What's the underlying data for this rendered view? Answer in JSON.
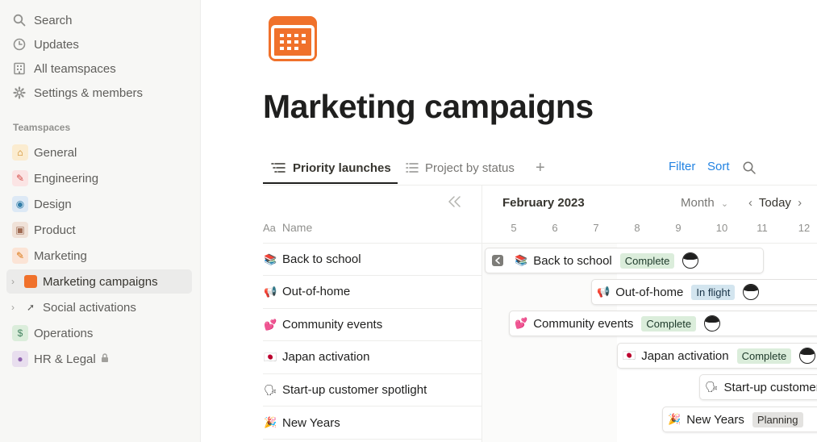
{
  "sidebar": {
    "nav": [
      {
        "label": "Search",
        "icon": "search-icon"
      },
      {
        "label": "Updates",
        "icon": "clock-icon"
      },
      {
        "label": "All teamspaces",
        "icon": "building-icon"
      },
      {
        "label": "Settings & members",
        "icon": "gear-icon"
      }
    ],
    "section_label": "Teamspaces",
    "teamspaces": [
      {
        "label": "General",
        "icon": "house-icon",
        "glyph": "⌂",
        "bg": "#fbecd0",
        "fg": "#c77d0e"
      },
      {
        "label": "Engineering",
        "icon": "wrench-icon",
        "glyph": "✎",
        "bg": "#fbe4e4",
        "fg": "#d44c47"
      },
      {
        "label": "Design",
        "icon": "palette-icon",
        "glyph": "◉",
        "bg": "#dde9f5",
        "fg": "#337ea9"
      },
      {
        "label": "Product",
        "icon": "box-icon",
        "glyph": "▣",
        "bg": "#f0e2d8",
        "fg": "#9f6b53"
      },
      {
        "label": "Marketing",
        "icon": "megaphone-icon",
        "glyph": "✎",
        "bg": "#fbe4d6",
        "fg": "#d9730d"
      },
      {
        "label": "Marketing campaigns",
        "icon": "calendar-icon"
      },
      {
        "label": "Social activations",
        "icon": "rocket-icon"
      },
      {
        "label": "Operations",
        "icon": "dollar-icon",
        "glyph": "$",
        "bg": "#dbeddb",
        "fg": "#448361"
      },
      {
        "label": "HR & Legal",
        "icon": "person-icon",
        "glyph": "●",
        "bg": "#e8deee",
        "fg": "#9065b0"
      }
    ]
  },
  "page": {
    "title": "Marketing campaigns",
    "icon": "calendar-icon",
    "accent": "#f0712b"
  },
  "tabs": {
    "items": [
      {
        "label": "Priority launches",
        "icon": "list-icon"
      },
      {
        "label": "Project by status",
        "icon": "list-icon"
      }
    ],
    "add": "+",
    "filter": "Filter",
    "sort": "Sort"
  },
  "table": {
    "column_type": "Aa",
    "column_name": "Name",
    "rows": [
      {
        "name": "Back to school",
        "emoji": "📚"
      },
      {
        "name": "Out-of-home",
        "emoji": "📢"
      },
      {
        "name": "Community events",
        "emoji": "💕"
      },
      {
        "name": "Japan activation",
        "emoji": "🇯🇵"
      },
      {
        "name": "Start-up customer spotlight",
        "emoji": "🗣"
      },
      {
        "name": "New Years",
        "emoji": "🎉"
      }
    ]
  },
  "timeline": {
    "month": "February 2023",
    "scale": "Month",
    "today": "Today",
    "days": [
      "5",
      "6",
      "7",
      "8",
      "9",
      "10",
      "11",
      "12"
    ],
    "items": [
      {
        "name": "Back to school",
        "emoji": "📚",
        "status": "Complete",
        "status_color": "green"
      },
      {
        "name": "Out-of-home",
        "emoji": "📢",
        "status": "In flight",
        "status_color": "blue"
      },
      {
        "name": "Community events",
        "emoji": "💕",
        "status": "Complete",
        "status_color": "green"
      },
      {
        "name": "Japan activation",
        "emoji": "🇯🇵",
        "status": "Complete",
        "status_color": "green"
      },
      {
        "name": "Start-up customer spotlight",
        "emoji": "🗣",
        "status": "",
        "status_color": ""
      },
      {
        "name": "New Years",
        "emoji": "🎉",
        "status": "Planning",
        "status_color": "gray"
      }
    ]
  }
}
